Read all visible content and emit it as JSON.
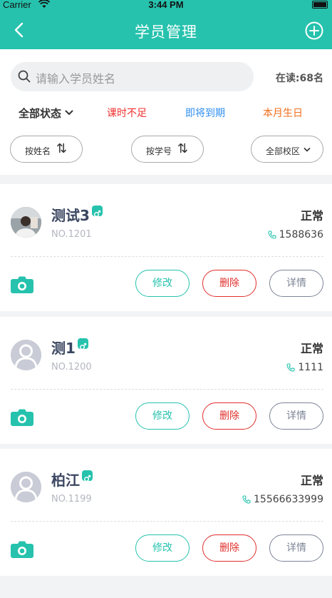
{
  "status_bar": {
    "carrier": "Carrier",
    "time": "3:44 PM"
  },
  "nav": {
    "title": "学员管理"
  },
  "search": {
    "placeholder": "请输入学员姓名"
  },
  "enrolled": "在读:68名",
  "tabs": [
    {
      "label": "全部状态"
    },
    {
      "label": "课时不足"
    },
    {
      "label": "即将到期"
    },
    {
      "label": "本月生日"
    }
  ],
  "sort": [
    {
      "label": "按姓名",
      "arrow": "⇅"
    },
    {
      "label": "按学号",
      "arrow": "⇅"
    },
    {
      "label": "全部校区"
    }
  ],
  "buttons": {
    "edit": "修改",
    "delete": "删除",
    "detail": "详情"
  },
  "students": [
    {
      "name": "测试3",
      "no": "NO.1201",
      "status": "正常",
      "phone": "1588636",
      "avatar": "photo"
    },
    {
      "name": "测1",
      "no": "NO.1200",
      "status": "正常",
      "phone": "1111",
      "avatar": "default"
    },
    {
      "name": "柏江",
      "no": "NO.1199",
      "status": "正常",
      "phone": "15566633999",
      "avatar": "default"
    }
  ],
  "colors": {
    "brand": "#26c2ad",
    "danger": "#e0302c",
    "info": "#2f8ff0",
    "warn": "#f06d1b"
  }
}
